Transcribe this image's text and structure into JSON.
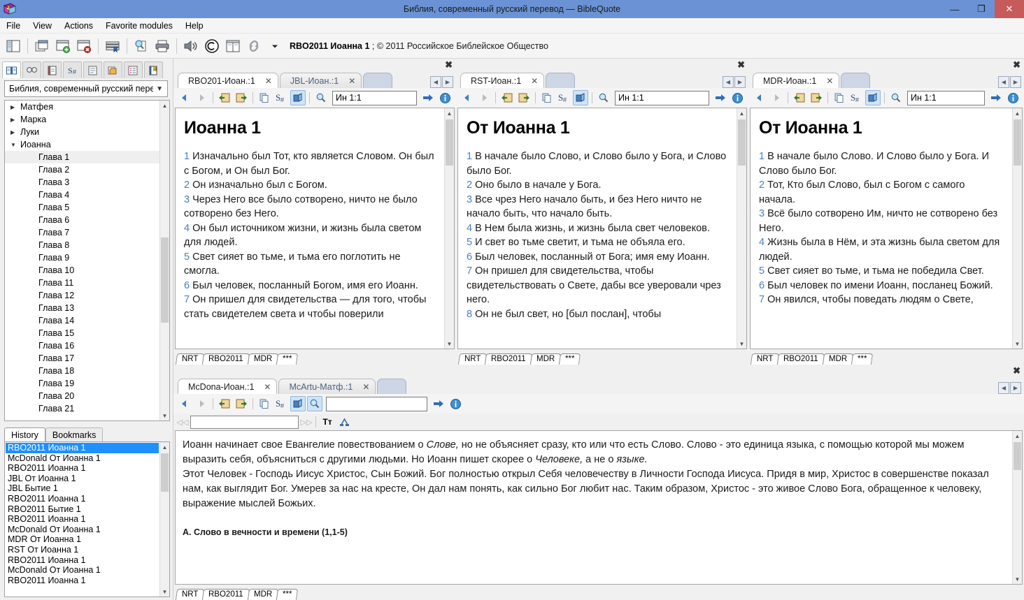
{
  "window": {
    "title": "Библия, современный русский перевод — BibleQuote",
    "logo_icon": "book-logo-icon",
    "minimize_label": "—",
    "restore_label": "❐",
    "close_label": "✕",
    "accent_color": "#6a92d4",
    "close_color": "#c75b5b"
  },
  "menu": {
    "items": [
      {
        "label": "File"
      },
      {
        "label": "View"
      },
      {
        "label": "Actions"
      },
      {
        "label": "Favorite modules"
      },
      {
        "label": "Help"
      }
    ]
  },
  "toolbar": {
    "buttons": [
      {
        "name": "toggle-sidebar-icon"
      },
      {
        "name": "tile-windows-icon"
      },
      {
        "name": "new-window-icon"
      },
      {
        "name": "close-window-icon"
      },
      {
        "name": "library-icon"
      },
      {
        "name": "search-document-icon"
      },
      {
        "name": "print-icon"
      },
      {
        "name": "speaker-icon"
      },
      {
        "name": "copyright-icon"
      },
      {
        "name": "split-view-icon"
      },
      {
        "name": "link-icon"
      },
      {
        "name": "dropdown-arrow-icon"
      }
    ],
    "module_ref": "RBO2011 Иоанна 1",
    "copyright": "; © 2011 Российское Библейское Общество"
  },
  "sidebar": {
    "tabs": [
      {
        "name": "bible-tab",
        "icon": "open-book-icon",
        "active": true
      },
      {
        "name": "search-tab",
        "icon": "binoculars-icon",
        "active": false
      },
      {
        "name": "notes-tab",
        "icon": "ruler-note-icon",
        "active": false
      },
      {
        "name": "strong-tab",
        "icon": "strong-number-icon",
        "active": false
      },
      {
        "name": "list-tab",
        "icon": "lines-icon",
        "active": false
      },
      {
        "name": "folder-tab",
        "icon": "folder-copy-icon",
        "active": false
      },
      {
        "name": "outline-tab",
        "icon": "outline-icon",
        "active": false
      },
      {
        "name": "bookmark-tab",
        "icon": "bookmark-book-icon",
        "active": false
      }
    ],
    "module_selected": "Библия, современный русский перев",
    "tree": [
      {
        "label": "Матфея",
        "type": "book",
        "expanded": false
      },
      {
        "label": "Марка",
        "type": "book",
        "expanded": false
      },
      {
        "label": "Луки",
        "type": "book",
        "expanded": false
      },
      {
        "label": "Иоанна",
        "type": "book",
        "expanded": true
      },
      {
        "label": "Глава 1",
        "type": "chapter",
        "selected": true
      },
      {
        "label": "Глава 2",
        "type": "chapter"
      },
      {
        "label": "Глава 3",
        "type": "chapter"
      },
      {
        "label": "Глава 4",
        "type": "chapter"
      },
      {
        "label": "Глава 5",
        "type": "chapter"
      },
      {
        "label": "Глава 6",
        "type": "chapter"
      },
      {
        "label": "Глава 7",
        "type": "chapter"
      },
      {
        "label": "Глава 8",
        "type": "chapter"
      },
      {
        "label": "Глава 9",
        "type": "chapter"
      },
      {
        "label": "Глава 10",
        "type": "chapter"
      },
      {
        "label": "Глава 11",
        "type": "chapter"
      },
      {
        "label": "Глава 12",
        "type": "chapter"
      },
      {
        "label": "Глава 13",
        "type": "chapter"
      },
      {
        "label": "Глава 14",
        "type": "chapter"
      },
      {
        "label": "Глава 15",
        "type": "chapter"
      },
      {
        "label": "Глава 16",
        "type": "chapter"
      },
      {
        "label": "Глава 17",
        "type": "chapter"
      },
      {
        "label": "Глава 18",
        "type": "chapter"
      },
      {
        "label": "Глава 19",
        "type": "chapter"
      },
      {
        "label": "Глава 20",
        "type": "chapter"
      },
      {
        "label": "Глава 21",
        "type": "chapter"
      }
    ],
    "history": {
      "tabs": [
        {
          "label": "History",
          "active": true
        },
        {
          "label": "Bookmarks",
          "active": false
        }
      ],
      "items": [
        {
          "label": "RBO2011 Иоанна 1",
          "selected": true
        },
        {
          "label": "McDonald От Иоанна 1"
        },
        {
          "label": "RBO2011 Иоанна 1"
        },
        {
          "label": "JBL От Иоанна 1"
        },
        {
          "label": "JBL Бытие 1"
        },
        {
          "label": "RBO2011 Иоанна 1"
        },
        {
          "label": "RBO2011 Бытие 1"
        },
        {
          "label": "RBO2011 Иоанна 1"
        },
        {
          "label": "McDonald От Иоанна 1"
        },
        {
          "label": "MDR От Иоанна 1"
        },
        {
          "label": "RST От Иоанна 1"
        },
        {
          "label": "RBO2011 Иоанна 1"
        },
        {
          "label": "McDonald От Иоанна 1"
        },
        {
          "label": "RBO2011 Иоанна 1"
        }
      ]
    }
  },
  "panel_toolbar_icons": [
    {
      "name": "back-arrow-icon"
    },
    {
      "name": "forward-arrow-icon"
    },
    {
      "name": "prev-chapter-icon"
    },
    {
      "name": "next-chapter-icon"
    },
    {
      "name": "copy-verse-icon"
    },
    {
      "name": "strong-numbers-icon"
    },
    {
      "name": "open-module-icon"
    },
    {
      "name": "search-icon"
    },
    {
      "name": "go-arrow-icon"
    },
    {
      "name": "info-icon"
    }
  ],
  "module_tabs": [
    "NRT",
    "RBO2011",
    "MDR",
    "***"
  ],
  "panels": [
    {
      "id": "panel-rbo",
      "tabs": [
        {
          "label": "RBO201-Иоан.:1",
          "active": true,
          "close": "✕"
        },
        {
          "label": "JBL-Иоан.:1",
          "active": false,
          "close": "✕"
        }
      ],
      "reference": "Ин 1:1",
      "chapter_title": "Иоанна 1",
      "verses": [
        {
          "n": "1",
          "text": "Изначально был Тот, кто является Словом. Он был с Богом, и Он был Бог."
        },
        {
          "n": "2",
          "text": "Он изначально был с Богом."
        },
        {
          "n": "3",
          "text": "Через Него все было сотворено, ничто не было сотворено без Него."
        },
        {
          "n": "4",
          "text": "Он был источником жизни, и жизнь была светом для людей."
        },
        {
          "n": "5",
          "text": "Свет сияет во тьме, и тьма его поглотить не смогла."
        },
        {
          "n": "6",
          "text": "Был человек, посланный Богом, имя его Иоанн."
        },
        {
          "n": "7",
          "text": "Он пришел для свидетельства — для того, чтобы стать свидетелем света и чтобы поверили"
        }
      ]
    },
    {
      "id": "panel-rst",
      "tabs": [
        {
          "label": "RST-Иоан.:1",
          "active": true,
          "close": "✕"
        }
      ],
      "reference": "Ин 1:1",
      "chapter_title": "От Иоанна 1",
      "verses": [
        {
          "n": "1",
          "text": "В начале было Слово, и Слово было у Бога, и Слово было Бог."
        },
        {
          "n": "2",
          "text": "Оно было в начале у Бога."
        },
        {
          "n": "3",
          "text": "Все чрез Него начало быть, и без Него ничто не начало быть, что начало быть."
        },
        {
          "n": "4",
          "text": "В Нем была жизнь, и жизнь была свет человеков."
        },
        {
          "n": "5",
          "text": "И свет во тьме светит, и тьма не объяла его."
        },
        {
          "n": "6",
          "text": "Был человек, посланный от Бога; имя ему Иоанн."
        },
        {
          "n": "7",
          "text": "Он пришел для свидетельства, чтобы свидетельствовать о Свете, дабы все уверовали чрез него."
        },
        {
          "n": "8",
          "text": "Он не был свет, но [был послан], чтобы"
        }
      ]
    },
    {
      "id": "panel-mdr",
      "tabs": [
        {
          "label": "MDR-Иоан.:1",
          "active": true,
          "close": "✕"
        }
      ],
      "reference": "Ин 1:1",
      "chapter_title": "От Иоанна 1",
      "verses": [
        {
          "n": "1",
          "text": "В начале было Слово. И Слово было у Бога. И Слово было Бог."
        },
        {
          "n": "2",
          "text": "Тот, Кто был Слово, был с Богом с самого начала."
        },
        {
          "n": "3",
          "text": "Всё было сотворено Им, ничто не сотворено без Него."
        },
        {
          "n": "4",
          "text": "Жизнь была в Нём, и эта жизнь была светом для людей."
        },
        {
          "n": "5",
          "text": "Свет сияет во тьме, и тьма не победила Свет."
        },
        {
          "n": "6",
          "text": "Был человек по имени Иоанн, посланец Божий."
        },
        {
          "n": "7",
          "text": "Он явился, чтобы поведать людям о Свете,"
        }
      ]
    }
  ],
  "bottom_panel": {
    "tabs": [
      {
        "label": "McDona-Иоан.:1",
        "active": true,
        "close": "✕"
      },
      {
        "label": "McArtu-Матф.:1",
        "active": false,
        "close": "✕"
      }
    ],
    "reference": "",
    "find_value": "",
    "find_icons": [
      {
        "name": "find-prev-icon"
      },
      {
        "name": "find-next-icon"
      },
      {
        "name": "font-size-icon",
        "label": "Tт"
      },
      {
        "name": "compare-icon"
      }
    ],
    "commentary_paragraph_1_a": "Иоанн начинает свое Евангелие повествованием о ",
    "commentary_paragraph_1_em1": "Слове,",
    "commentary_paragraph_1_b": " но не объясняет сразу, кто или что есть Слово. Слово - это единица языка, с помощью которой мы можем выразить себя, объясниться с другими людьми. Но Иоанн пишет скорее о ",
    "commentary_paragraph_1_em2": "Человеке,",
    "commentary_paragraph_1_c": " а не о ",
    "commentary_paragraph_1_em3": "языке.",
    "commentary_paragraph_2": "Этот Человек - Господь Иисус Христос, Сын Божий. Бог полностью открыл Себя человечеству в Личности Господа Иисуса. Придя в мир, Христос в совершенстве показал нам, как выглядит Бог. Умерев за нас на кресте, Он дал нам понять, как сильно Бог любит нас. Таким образом, Христос - это живое Слово Бога, обращенное к человеку, выражение мыслей Божьих.",
    "commentary_heading": "А. Слово в вечности и времени (1,1-5)"
  }
}
